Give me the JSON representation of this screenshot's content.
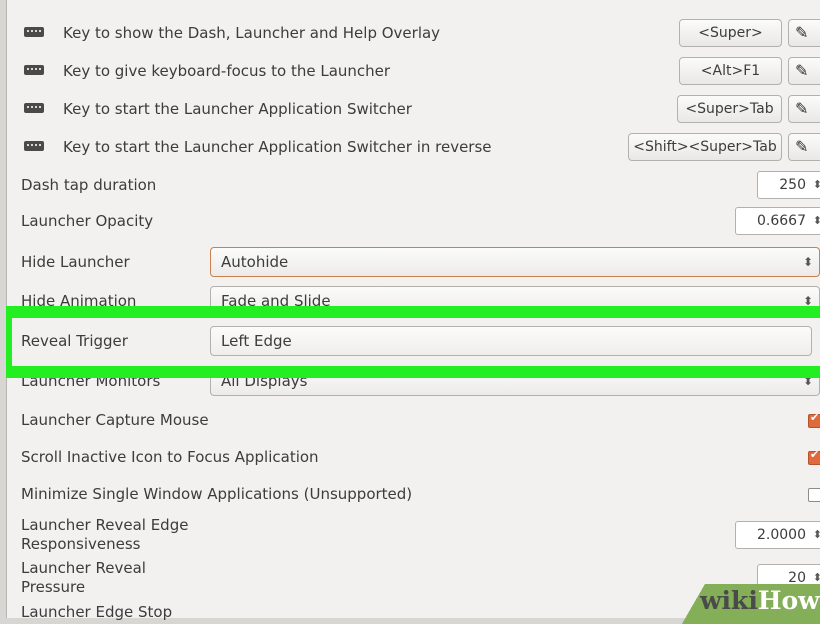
{
  "keybindings": [
    {
      "label": "Key to show the Dash, Launcher and Help Overlay",
      "key": "<Super>",
      "edit_glyph": "✎"
    },
    {
      "label": "Key to give keyboard-focus to the Launcher",
      "key": "<Alt>F1",
      "edit_glyph": "✎"
    },
    {
      "label": "Key to start the Launcher Application Switcher",
      "key": "<Super>Tab",
      "edit_glyph": "✎"
    },
    {
      "label": "Key to start the Launcher Application Switcher in reverse",
      "key": "<Shift><Super>Tab",
      "edit_glyph": "✎"
    }
  ],
  "spin_rows": {
    "dash_tap": {
      "label": "Dash tap duration",
      "value": "250"
    },
    "opacity": {
      "label": "Launcher Opacity",
      "value": "0.6667"
    }
  },
  "combos": {
    "hide_launcher": {
      "label": "Hide Launcher",
      "value": "Autohide"
    },
    "hide_animation": {
      "label": "Hide Animation",
      "value": "Fade and Slide"
    },
    "reveal_trigger": {
      "label": "Reveal Trigger",
      "value": "Left Edge"
    },
    "launcher_monitors": {
      "label": "Launcher Monitors",
      "value": "All Displays"
    }
  },
  "checks": {
    "capture_mouse": {
      "label": "Launcher Capture Mouse",
      "checked": true
    },
    "scroll_inactive": {
      "label": "Scroll Inactive Icon to Focus Application",
      "checked": true
    },
    "minimize_single": {
      "label": "Minimize Single Window Applications (Unsupported)",
      "checked": false
    }
  },
  "bottom_rows": {
    "edge_responsiveness": {
      "label_line1": "Launcher Reveal Edge",
      "label_line2": "Responsiveness",
      "value": "2.0000"
    },
    "reveal_pressure": {
      "label_line1": "Launcher Reveal",
      "label_line2": "Pressure",
      "value": "20"
    },
    "edge_stop": {
      "label": "Launcher Edge Stop"
    }
  },
  "arrows": {
    "spin": "⬍",
    "combo": "⬍"
  },
  "watermark": {
    "part1": "wiki",
    "part2": "How"
  },
  "colors": {
    "highlight": "#22ee22",
    "check_on": "#e06a3b",
    "watermark_green": "#84ae58"
  }
}
